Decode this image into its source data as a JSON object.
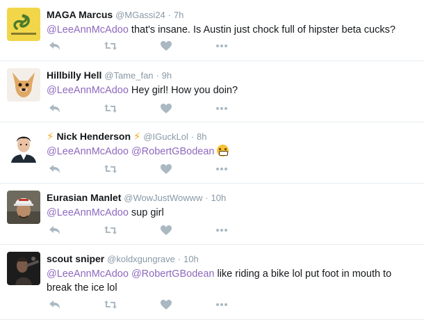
{
  "tweets": [
    {
      "name": "MAGA Marcus",
      "handle": "@MGassi24",
      "dot": "·",
      "time": "7h",
      "segments": [
        {
          "mention": "@LeeAnnMcAdoo"
        },
        {
          "text": " that's insane. Is Austin just chock full of hipster beta cucks?"
        }
      ],
      "avatar_caption": "DONT TREAD ON ME"
    },
    {
      "name": "Hillbilly Hell",
      "handle": "@Tame_fan",
      "dot": "·",
      "time": "9h",
      "segments": [
        {
          "mention": "@LeeAnnMcAdoo"
        },
        {
          "text": " Hey girl! How you doin?"
        }
      ]
    },
    {
      "name": "Nick Henderson",
      "name_prefix": "⚡",
      "name_suffix": "⚡",
      "handle": "@IGuckLol",
      "dot": "·",
      "time": "8h",
      "segments": [
        {
          "mention": "@LeeAnnMcAdoo"
        },
        {
          "text": " "
        },
        {
          "mention": "@RobertGBodean"
        },
        {
          "text": " "
        },
        {
          "emoji": "grimacing-face"
        }
      ]
    },
    {
      "name": "Eurasian Manlet",
      "handle": "@WowJustWowww",
      "dot": "·",
      "time": "10h",
      "segments": [
        {
          "mention": "@LeeAnnMcAdoo"
        },
        {
          "text": " sup girl"
        }
      ]
    },
    {
      "name": "scout sniper",
      "handle": "@koldxgungrave",
      "dot": "·",
      "time": "10h",
      "segments": [
        {
          "mention": "@LeeAnnMcAdoo"
        },
        {
          "text": " "
        },
        {
          "mention": "@RobertGBodean"
        },
        {
          "text": " like riding a bike lol put foot in mouth to break the ice lol"
        }
      ]
    }
  ],
  "icons": {
    "reply": "reply-icon",
    "retweet": "retweet-icon",
    "like": "heart-icon",
    "more": "more-icon"
  },
  "colors": {
    "mention": "#8e68bf",
    "muted": "#8899a6",
    "action_icon": "#aab8c2",
    "divider": "#e6ecf0",
    "bolt": "#f5a623"
  }
}
